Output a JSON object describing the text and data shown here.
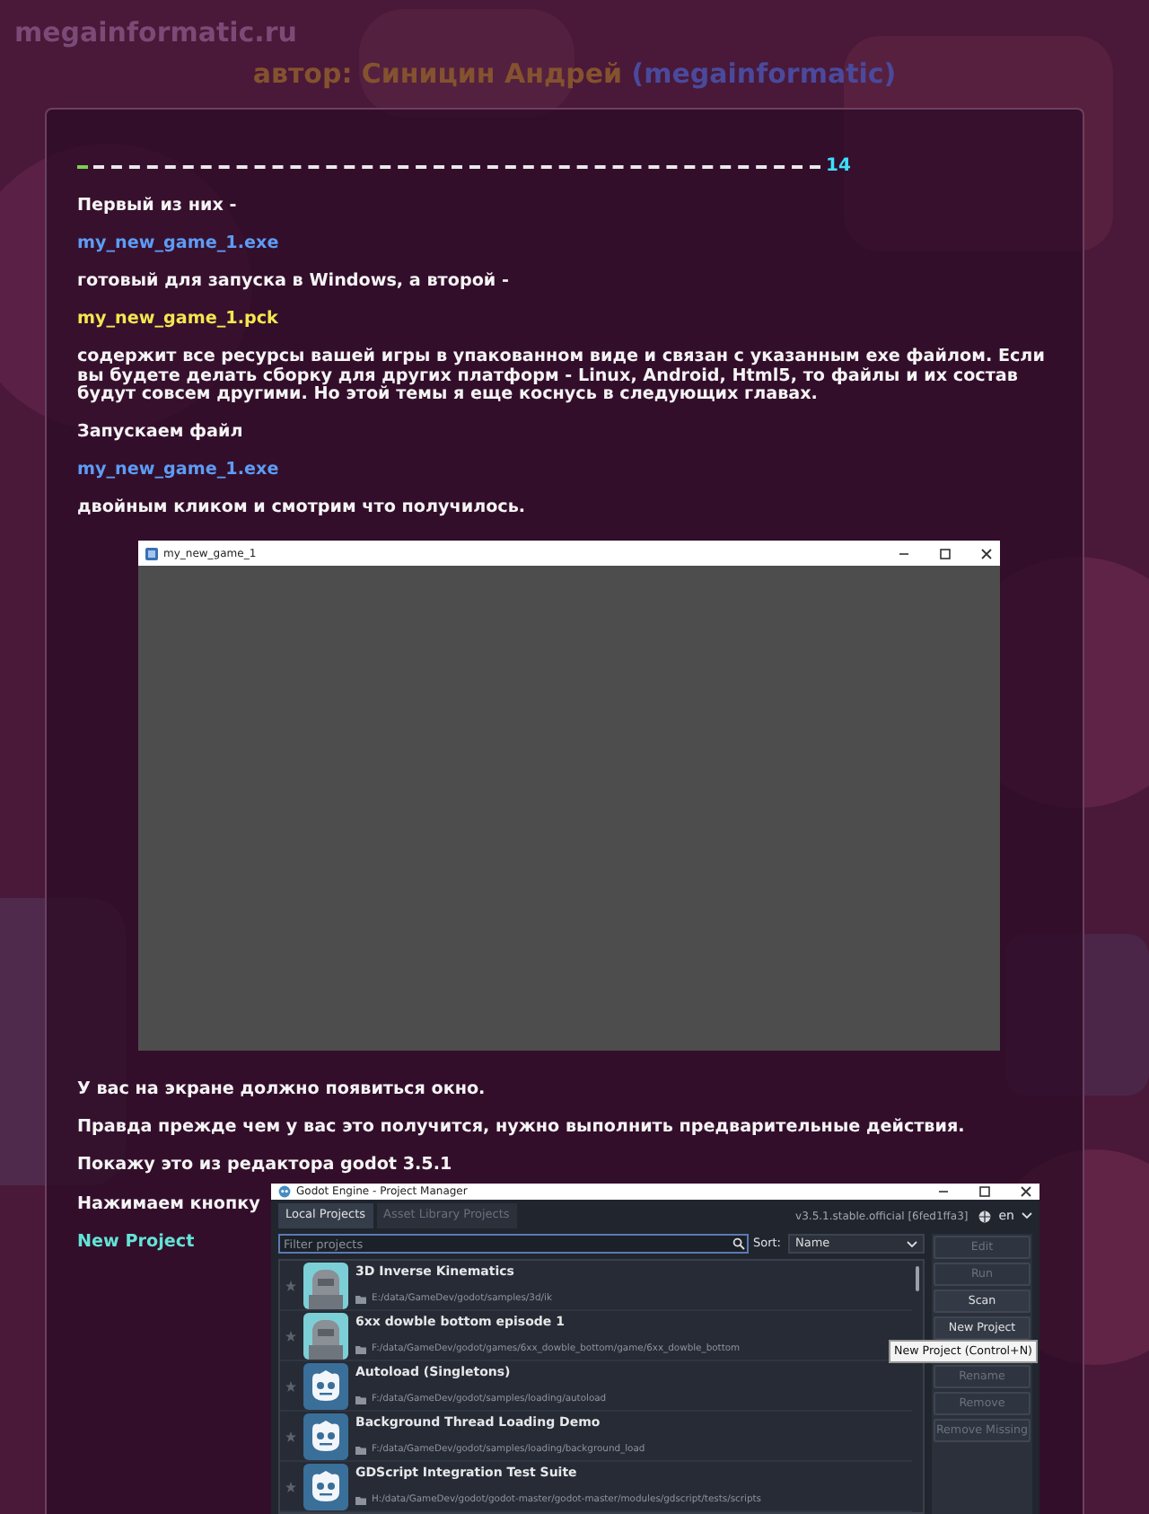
{
  "site": {
    "title": "megainformatic.ru"
  },
  "author": {
    "label": "автор: Синицин Андрей",
    "handle": "(megainformatic)"
  },
  "page_counter": "14",
  "blocks_before": [
    {
      "kind": "text",
      "text": "Первый из них -"
    },
    {
      "kind": "exe",
      "text": "my_new_game_1.exe"
    },
    {
      "kind": "text",
      "text": "готовый для запуска в Windows, а второй -"
    },
    {
      "kind": "pck",
      "text": "my_new_game_1.pck"
    },
    {
      "kind": "text",
      "text": "содержит все ресурсы вашей игры в упакованном виде и связан с указанным exe файлом. Если вы будете делать сборку для других платформ - Linux, Android, Html5, то файлы и их состав будут совсем другими. Но этой темы я еще коснусь в следующих главах."
    },
    {
      "kind": "text",
      "text": "Запускаем файл"
    },
    {
      "kind": "exe",
      "text": "my_new_game_1.exe"
    },
    {
      "kind": "text",
      "text": "двойным кликом и смотрим что получилось."
    }
  ],
  "game_window": {
    "title": "my_new_game_1"
  },
  "blocks_after": [
    {
      "kind": "text",
      "text": "У вас на экране должно появиться окно."
    },
    {
      "kind": "text",
      "text": "Правда прежде чем у вас это получится, нужно выполнить предварительные действия."
    },
    {
      "kind": "text",
      "text": "Покажу это из редактора godot 3.5.1"
    }
  ],
  "side_texts": [
    {
      "kind": "text",
      "text": "Нажимаем кнопку"
    },
    {
      "kind": "action",
      "text": "New Project"
    }
  ],
  "godot": {
    "title": "Godot Engine - Project Manager",
    "tabs": [
      {
        "label": "Local Projects",
        "selected": true
      },
      {
        "label": "Asset Library Projects",
        "selected": false
      }
    ],
    "version": "v3.5.1.stable.official [6fed1ffa3]",
    "language": "en",
    "filter": {
      "placeholder": "Filter projects"
    },
    "sort": {
      "label": "Sort:",
      "value": "Name"
    },
    "projects": [
      {
        "name": "3D Inverse Kinematics",
        "path": "E:/data/GameDev/godot/samples/3d/ik",
        "kind": "picture"
      },
      {
        "name": "6xx dowble bottom episode 1",
        "path": "F:/data/GameDev/godot/games/6xx_dowble_bottom/game/6xx_dowble_bottom",
        "kind": "picture"
      },
      {
        "name": "Autoload (Singletons)",
        "path": "F:/data/GameDev/godot/samples/loading/autoload",
        "kind": "robot"
      },
      {
        "name": "Background Thread Loading Demo",
        "path": "F:/data/GameDev/godot/samples/loading/background_load",
        "kind": "robot"
      },
      {
        "name": "GDScript Integration Test Suite",
        "path": "H:/data/GameDev/godot/godot-master/godot-master/modules/gdscript/tests/scripts",
        "kind": "robot"
      }
    ],
    "buttons": [
      {
        "label": "Edit",
        "disabled": true,
        "group_break": false
      },
      {
        "label": "Run",
        "disabled": true,
        "group_break": false
      },
      {
        "label": "Scan",
        "disabled": false,
        "group_break": false
      },
      {
        "label": "New Project",
        "disabled": false,
        "group_break": false
      },
      {
        "label": "Rename",
        "disabled": true,
        "group_break": true
      },
      {
        "label": "Remove",
        "disabled": true,
        "group_break": false
      },
      {
        "label": "Remove Missing",
        "disabled": true,
        "group_break": false
      }
    ],
    "tooltip": "New Project (Control+N)"
  }
}
